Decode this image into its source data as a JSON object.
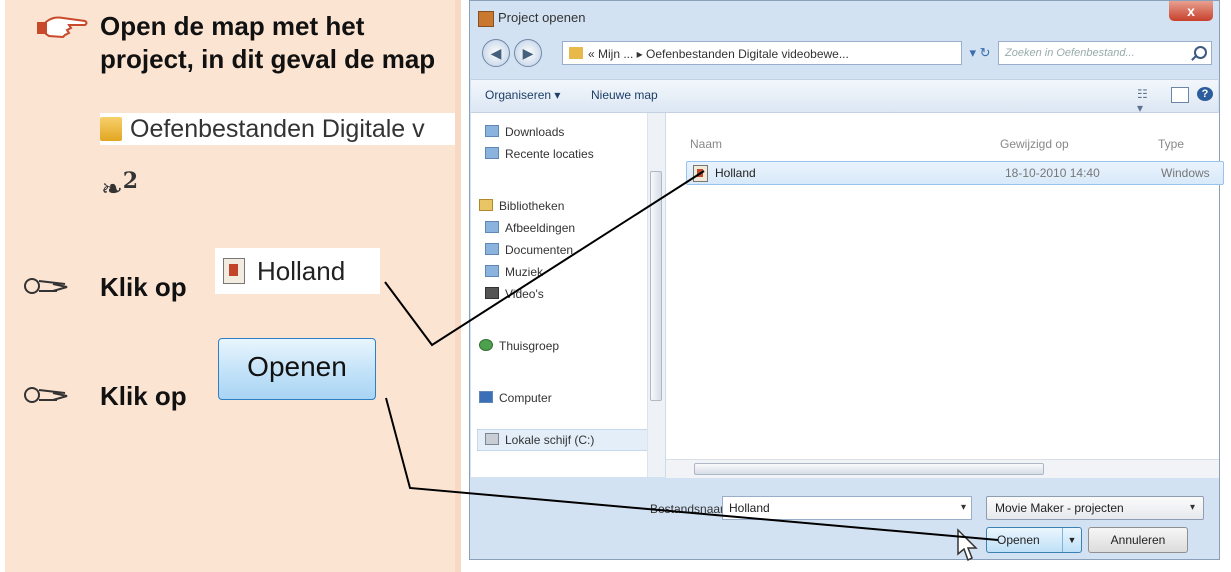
{
  "instructions": {
    "step_title": "Open de map met het project, in dit geval de map",
    "folder_path": "Oefenbestanden Digitale v",
    "step_ref": "2",
    "click_label_1": "Klik op",
    "holland_label": "Holland",
    "click_label_2": "Klik op",
    "openen_label": "Openen"
  },
  "dialog": {
    "title": "Project openen",
    "close": "x",
    "address": "« Mijn ... ▸ Oefenbestanden Digitale videobewe...",
    "search_placeholder": "Zoeken in Oefenbestand...",
    "toolbar": {
      "organise": "Organiseren ▾",
      "new_folder": "Nieuwe map"
    },
    "nav_items": [
      "Downloads",
      "Recente locaties",
      "Bibliotheken",
      "Afbeeldingen",
      "Documenten",
      "Muziek",
      "Video's",
      "Thuisgroep",
      "Computer",
      "Lokale schijf (C:)"
    ],
    "columns": {
      "name": "Naam",
      "modified": "Gewijzigd op",
      "type": "Type"
    },
    "files": [
      {
        "name": "Holland",
        "modified": "18-10-2010 14:40",
        "type": "Windows"
      }
    ],
    "filename_label": "Bestandsnaam:",
    "filename_value": "Holland",
    "filetype": "Movie Maker - projecten",
    "open_button": "Openen",
    "cancel_button": "Annuleren"
  },
  "colors": {
    "panel_bg": "#fce4d3",
    "dialog_bg": "#d3e2f3",
    "callout_line": "#000000"
  }
}
